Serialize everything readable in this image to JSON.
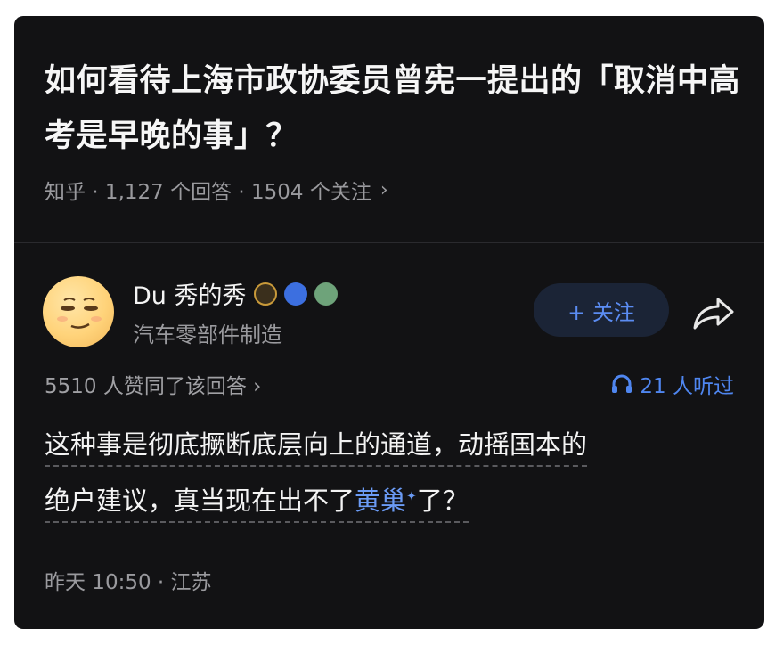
{
  "question": {
    "title": "如何看待上海市政协委员曾宪一提出的「取消中高考是早晚的事」？",
    "meta": "知乎 · 1,127 个回答 · 1504 个关注",
    "chevron": "›"
  },
  "author": {
    "name": "Du 秀的秀",
    "subtitle": "汽车零部件制造",
    "badges": [
      "crown-badge-icon",
      "gem-badge-icon",
      "avatar-badge-icon"
    ]
  },
  "actions": {
    "follow_label": "+ 关注",
    "share_icon": "share-icon"
  },
  "stats": {
    "agree": "5510 人赞同了该回答 ›",
    "listen": "21 人听过"
  },
  "answer": {
    "line1": "这种事是彻底撅断底层向上的通道，动摇国本的",
    "line2_before": "绝户建议，真当现在出不了",
    "line2_link": "黄巢",
    "line2_after": "了？",
    "link_marker": "✦"
  },
  "footer": {
    "time_location": "昨天 10:50 · 江苏"
  },
  "colors": {
    "background": "#121214",
    "accent": "#4f86f0",
    "text_primary": "#f4f4f4",
    "text_secondary": "#9a9a9e"
  }
}
